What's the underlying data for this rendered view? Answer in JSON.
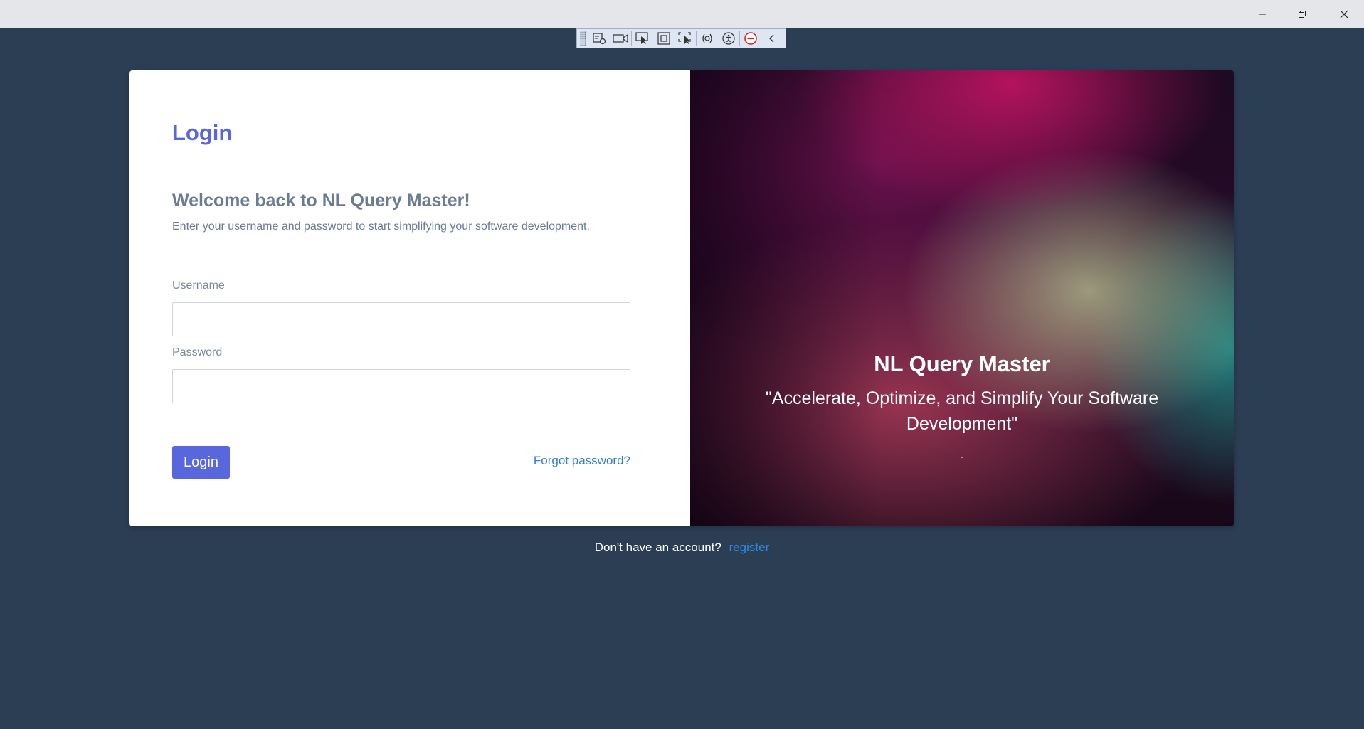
{
  "login": {
    "title": "Login",
    "welcome": "Welcome back to NL Query Master!",
    "intro": "Enter your username and password to start simplifying your software development.",
    "username_label": "Username",
    "password_label": "Password",
    "username_value": "",
    "password_value": "",
    "login_button": "Login",
    "forgot_link": "Forgot password?"
  },
  "promo": {
    "brand": "NL Query Master",
    "tagline": "\"Accelerate, Optimize, and Simplify Your Software Development\"",
    "attribution": "-"
  },
  "footer": {
    "prompt": "Don't have an account?",
    "register_link": "register"
  },
  "devtoolbar": {
    "tools": [
      "live-visual-tree-icon",
      "record-icon",
      "select-element-icon",
      "display-layout-adorners-icon",
      "track-focus-icon",
      "binding-failures-icon",
      "accessibility-icon",
      "hot-reload-stop-icon",
      "collapse-icon"
    ]
  },
  "colors": {
    "background": "#2c3e54",
    "accent": "#5867dd",
    "link": "#2f7fd6"
  }
}
